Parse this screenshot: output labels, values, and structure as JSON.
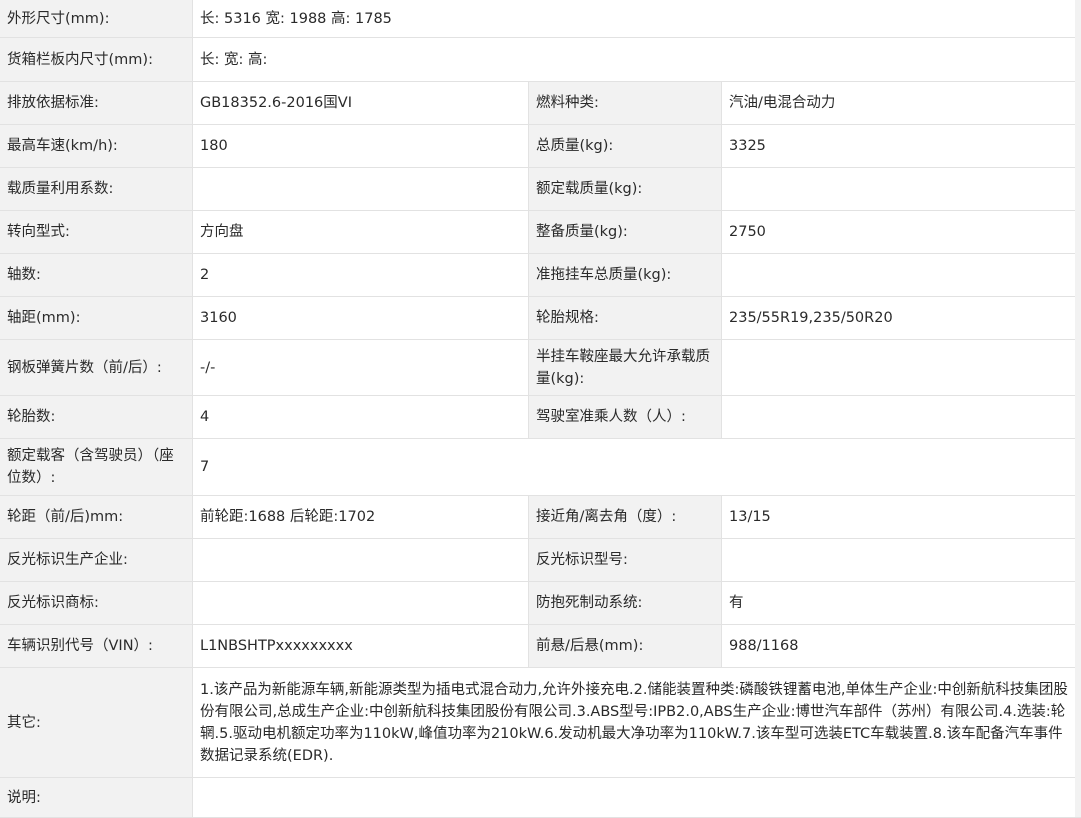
{
  "rows": {
    "outer": {
      "label": "外形尺寸(mm):",
      "value": "长: 5316 宽: 1988 高: 1785"
    },
    "cargo": {
      "label": "货箱栏板内尺寸(mm):",
      "value": "长:  宽:  高:"
    },
    "emission": {
      "label": "排放依据标准:",
      "value": "GB18352.6-2016国VI",
      "label2": "燃料种类:",
      "value2": "汽油/电混合动力"
    },
    "speed": {
      "label": "最高车速(km/h):",
      "value": "180",
      "label2": "总质量(kg):",
      "value2": "3325"
    },
    "load_coef": {
      "label": "载质量利用系数:",
      "value": "",
      "label2": "额定载质量(kg):",
      "value2": ""
    },
    "steering": {
      "label": "转向型式:",
      "value": "方向盘",
      "label2": "整备质量(kg):",
      "value2": "2750"
    },
    "axles": {
      "label": "轴数:",
      "value": "2",
      "label2": "准拖挂车总质量(kg):",
      "value2": ""
    },
    "wheelbase": {
      "label": "轴距(mm):",
      "value": "3160",
      "label2": "轮胎规格:",
      "value2": "235/55R19,235/50R20"
    },
    "spring": {
      "label": "钢板弹簧片数（前/后）:",
      "value": "-/-",
      "label2": "半挂车鞍座最大允许承载质量(kg):",
      "value2": ""
    },
    "tires": {
      "label": "轮胎数:",
      "value": "4",
      "label2": "驾驶室准乘人数（人）:",
      "value2": ""
    },
    "seats": {
      "label": "额定载客（含驾驶员）（座位数）:",
      "value": "7"
    },
    "track": {
      "label": "轮距（前/后)mm:",
      "value": "前轮距:1688 后轮距:1702",
      "label2": "接近角/离去角（度）:",
      "value2": "13/15"
    },
    "reflect_maker": {
      "label": "反光标识生产企业:",
      "value": "",
      "label2": "反光标识型号:",
      "value2": ""
    },
    "reflect_brand": {
      "label": "反光标识商标:",
      "value": "",
      "label2": "防抱死制动系统:",
      "value2": "有"
    },
    "vin": {
      "label": "车辆识别代号（VIN）:",
      "value": "L1NBSHTPxxxxxxxxx",
      "label2": "前悬/后悬(mm):",
      "value2": "988/1168"
    },
    "other": {
      "label": "其它:",
      "value": "1.该产品为新能源车辆,新能源类型为插电式混合动力,允许外接充电.2.储能装置种类:磷酸铁锂蓄电池,单体生产企业:中创新航科技集团股份有限公司,总成生产企业:中创新航科技集团股份有限公司.3.ABS型号:IPB2.0,ABS生产企业:博世汽车部件（苏州）有限公司.4.选装:轮辋.5.驱动电机额定功率为110kW,峰值功率为210kW.6.发动机最大净功率为110kW.7.该车型可选装ETC车载装置.8.该车配备汽车事件数据记录系统(EDR)."
    },
    "notes": {
      "label": "说明:",
      "value": ""
    }
  },
  "colors": {
    "label_bg": "#f2f2f2",
    "value_bg": "#ffffff",
    "border": "#e2e2e2",
    "text": "#2a2a2a"
  }
}
